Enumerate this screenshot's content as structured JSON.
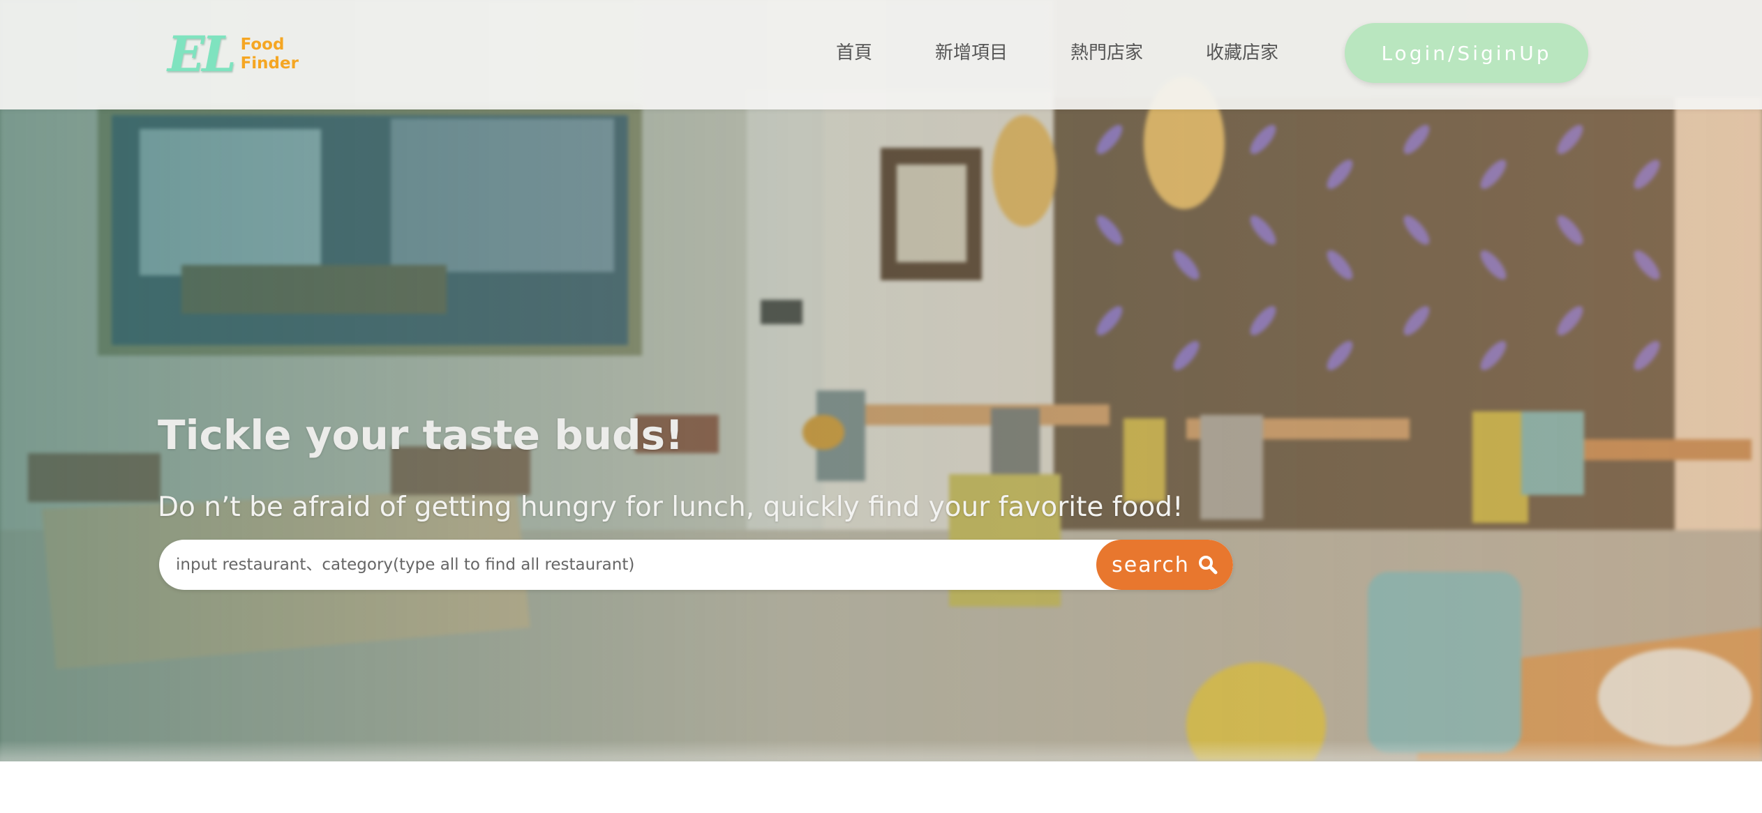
{
  "brand": {
    "logo_mark": "EL",
    "logo_line1": "Food",
    "logo_line2": "Finder"
  },
  "nav": {
    "items": [
      {
        "label": "首頁"
      },
      {
        "label": "新增項目"
      },
      {
        "label": "熱門店家"
      },
      {
        "label": "收藏店家"
      }
    ],
    "login_label": "Login/SiginUp"
  },
  "hero": {
    "title": "Tickle your taste buds!",
    "subtitle": "Do n’t be afraid of getting hungry for lunch, quickly find your favorite food!"
  },
  "search": {
    "placeholder": "input restaurant、category(type all to find all restaurant)",
    "value": "",
    "button_label": "search",
    "button_icon": "search-icon"
  },
  "colors": {
    "logo_mark": "#7fe3bf",
    "logo_words": "#f5a623",
    "login_button": "#b9e6bf",
    "search_button": "#e8772e",
    "nav_text": "#555555"
  }
}
